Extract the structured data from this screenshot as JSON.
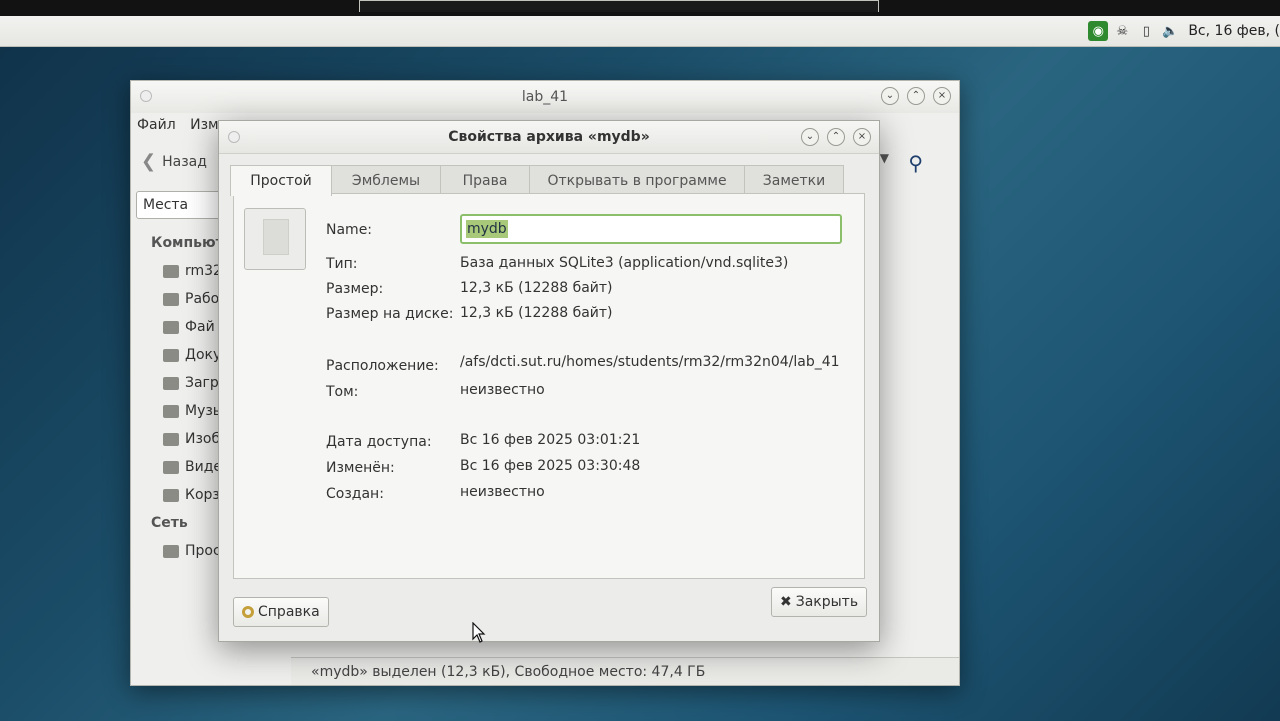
{
  "panel": {
    "clock": "Вс, 16 фев, ("
  },
  "file_manager": {
    "title": "lab_41",
    "menu": [
      "Файл",
      "Изм"
    ],
    "back_label": "Назад",
    "places_select": "Места",
    "sidebar": {
      "computer_heading": "Компьют",
      "computer_items": [
        "rm32",
        "Рабо",
        "Фай",
        "Доку",
        "Загр",
        "Музь",
        "Изоб",
        "Виде",
        "Корз"
      ],
      "network_heading": "Сеть",
      "network_items": [
        "Прос"
      ]
    },
    "status": "«mydb» выделен (12,3 кБ), Свободное место: 47,4 ГБ"
  },
  "dialog": {
    "title": "Свойства архива «mydb»",
    "tabs": [
      "Простой",
      "Эмблемы",
      "Права",
      "Открывать в программе",
      "Заметки"
    ],
    "active_tab": "Простой",
    "name_label": "Name:",
    "name_value": "mydb",
    "type_label": "Тип:",
    "type_value": "База данных SQLite3 (application/vnd.sqlite3)",
    "size_label": "Размер:",
    "size_value": "12,3 кБ (12288 байт)",
    "disk_size_label": "Размер на диске:",
    "disk_size_value": "12,3 кБ (12288 байт)",
    "location_label": "Расположение:",
    "location_value": "/afs/dcti.sut.ru/homes/students/rm32/rm32n04/lab_41",
    "volume_label": "Том:",
    "volume_value": "неизвестно",
    "accessed_label": "Дата доступа:",
    "accessed_value": "Вс 16 фев 2025 03:01:21",
    "modified_label": "Изменён:",
    "modified_value": "Вс 16 фев 2025 03:30:48",
    "created_label": "Создан:",
    "created_value": "неизвестно",
    "help_button": "Справка",
    "close_button": "Закрыть"
  }
}
